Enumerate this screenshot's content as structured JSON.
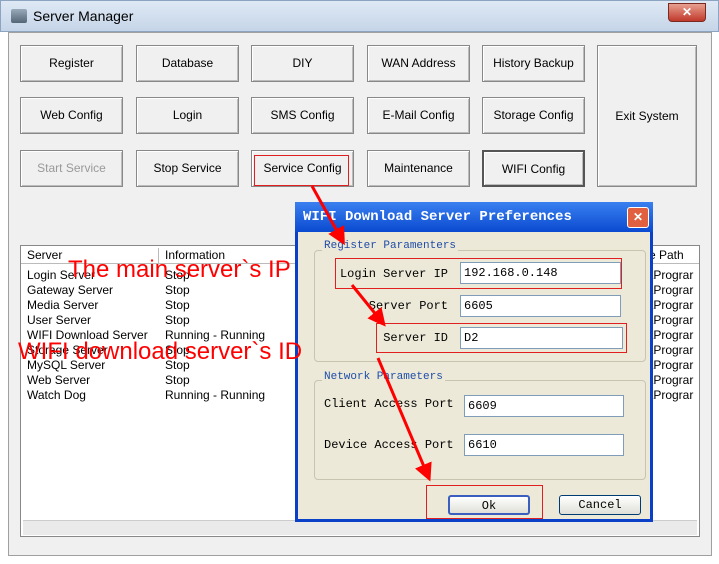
{
  "window": {
    "title": "Server Manager",
    "close": "✕"
  },
  "buttons": [
    [
      "Register",
      "Database",
      "DIY",
      "WAN Address",
      "History Backup"
    ],
    [
      "Web Config",
      "Login",
      "SMS Config",
      "E-Mail Config",
      "Storage Config"
    ],
    [
      "Start Service",
      "Stop Service",
      "Service Config",
      "Maintenance",
      "WIFI Config"
    ]
  ],
  "exit_label": "Exit System",
  "list": {
    "columns": [
      "Server",
      "Information",
      "e Path"
    ],
    "rows": [
      [
        "Login Server",
        "Stop",
        "\\Prograr"
      ],
      [
        "Gateway Server",
        "Stop",
        "\\Prograr"
      ],
      [
        "Media Server",
        "Stop",
        "\\Prograr"
      ],
      [
        "User Server",
        "Stop",
        "\\Prograr"
      ],
      [
        "WIFI Download Server",
        "Running - Running",
        "\\Prograr"
      ],
      [
        "Storage Server",
        "Stop",
        "\\Prograr"
      ],
      [
        "MySQL Server",
        "Stop",
        "\\Prograr"
      ],
      [
        "Web Server",
        "Stop",
        "\\Prograr"
      ],
      [
        "Watch Dog",
        "Running - Running",
        "\\Prograr"
      ]
    ]
  },
  "dialog": {
    "title": "WIFI Download Server Preferences",
    "close": "✕",
    "register_group": "Register Paramenters",
    "login_ip_label": "Login Server IP",
    "login_ip": "192.168.0.148",
    "server_port_label": "Server Port",
    "server_port": "6605",
    "server_id_label": "Server ID",
    "server_id": "D2",
    "network_group": "Network Parameters",
    "client_port_label": "Client Access Port",
    "client_port": "6609",
    "device_port_label": "Device Access Port",
    "device_port": "6610",
    "ok": "Ok",
    "cancel": "Cancel"
  },
  "annotations": {
    "ip": "The main server`s IP",
    "id": "WIFI download server`s ID",
    "color": "#ff0000"
  }
}
